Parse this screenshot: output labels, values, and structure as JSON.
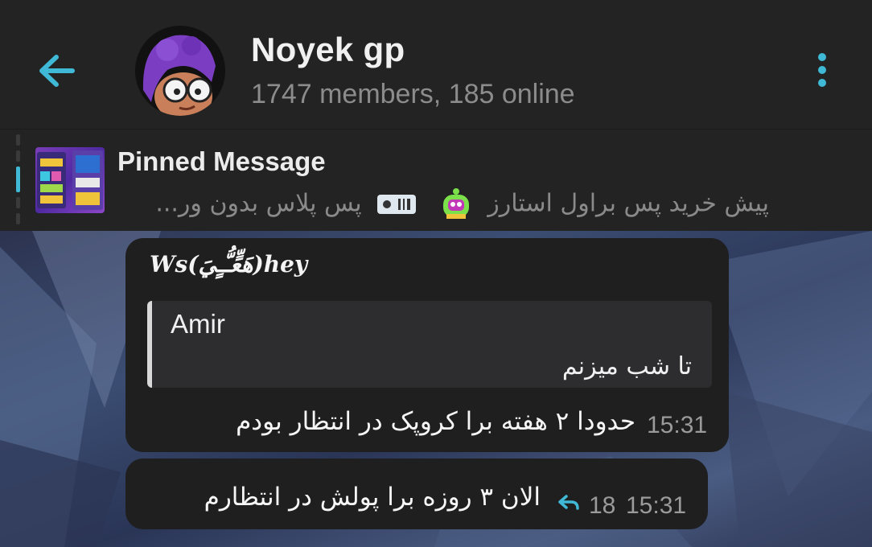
{
  "header": {
    "title": "Noyek gp",
    "subtitle": "1747 members, 185 online"
  },
  "pinned": {
    "title": "Pinned Message",
    "preview": "پیش خرید پس براول استارز 🤖 پس پلاس بدون ور...",
    "preview_main": "پیش خرید پس براول استارز",
    "preview_tail": "پس پلاس بدون ور..."
  },
  "messages": [
    {
      "sender": "Ws(هَعٍّـُّـٍيَ)𝒉𝒆𝒚",
      "reply_to_name": "Amir",
      "reply_to_text": "تا شب میزنم",
      "text": "حدودا ۲ هفته برا کروپک در انتظار بودم",
      "time": "15:31"
    },
    {
      "text": "الان ۳ روزه برا پولش در انتظارم",
      "reply_count": "18",
      "time": "15:31"
    }
  ],
  "colors": {
    "accent": "#3fb9d6",
    "header_bg": "#232323",
    "bubble_bg": "#1f1f20"
  },
  "icons": {
    "back": "arrow-left-icon",
    "menu": "more-vertical-icon",
    "pin_list": "pin-list-icon",
    "reply_arrow": "reply-icon"
  }
}
